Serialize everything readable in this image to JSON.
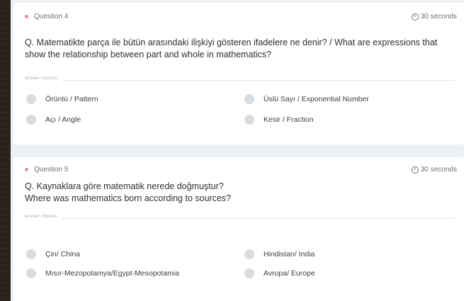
{
  "questions": [
    {
      "number_label": "Question 4",
      "time_label": "30 seconds",
      "text": "Q. Matematikte parça ile bütün arasındaki ilişkiyi gösteren ifadelere ne denir? / What are expressions that show the relationship between part and whole in mathematics?",
      "answer_choices_label": "answer choices",
      "choices": [
        "Örüntü / Pattern",
        "Üslü Sayı / Exponential Number",
        "Açı / Angle",
        "Kesir / Fraction"
      ]
    },
    {
      "number_label": "Question 5",
      "time_label": "30 seconds",
      "text_lines": [
        "Q. Kaynaklara göre matematik nerede doğmuştur?",
        "Where was mathematics born according to sources?"
      ],
      "answer_choices_label": "answer choices",
      "choices": [
        "Çin/ China",
        "Hindistan/ India",
        "Mısır-Mezopotamya/Egypt-Mesopotamia",
        "Avrupa/ Europe"
      ]
    }
  ],
  "colors": {
    "accent_dot": "#e38d9d",
    "page_bg": "#eceff3",
    "radio_fill": "#d9dcdf"
  }
}
